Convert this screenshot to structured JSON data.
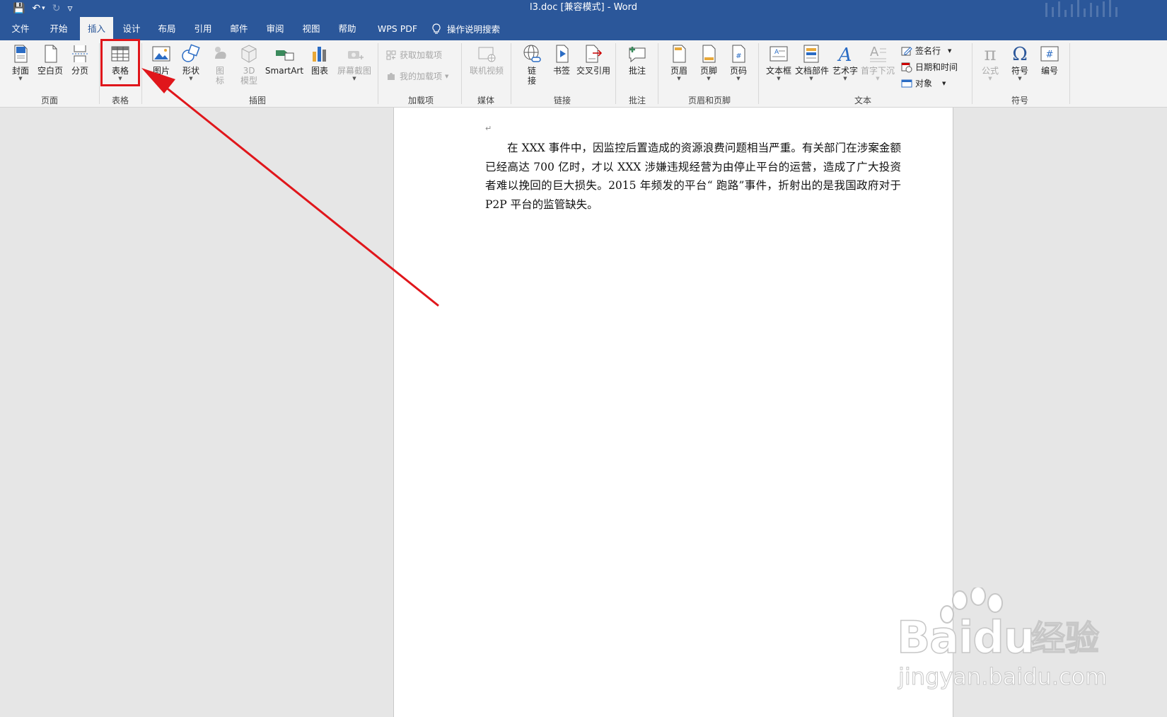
{
  "titlebar": {
    "title": "l3.doc [兼容模式]  -  Word",
    "qat": {
      "save": "💾",
      "undo": "↶",
      "undo_caret": "▾",
      "redo": "↻",
      "customize": "▿"
    }
  },
  "tabs": [
    {
      "label": "文件"
    },
    {
      "label": "开始"
    },
    {
      "label": "插入"
    },
    {
      "label": "设计"
    },
    {
      "label": "布局"
    },
    {
      "label": "引用"
    },
    {
      "label": "邮件"
    },
    {
      "label": "审阅"
    },
    {
      "label": "视图"
    },
    {
      "label": "帮助"
    },
    {
      "label": "WPS PDF"
    }
  ],
  "active_tab": "插入",
  "tell_me": "操作说明搜索",
  "ribbon": {
    "pages": {
      "label": "页面",
      "cover": "封面",
      "blank": "空白页",
      "break": "分页"
    },
    "tables": {
      "label": "表格",
      "table": "表格"
    },
    "illustrations": {
      "label": "插图",
      "picture": "图片",
      "shapes": "形状",
      "icons_1": "图",
      "icons_2": "标",
      "model_1": "3D",
      "model_2": "模型",
      "smartart": "SmartArt",
      "chart": "图表",
      "screenshot": "屏幕截图"
    },
    "addins": {
      "label": "加载项",
      "get": "获取加载项",
      "mine": "我的加载项"
    },
    "media": {
      "label": "媒体",
      "online_video": "联机视频"
    },
    "links": {
      "label": "链接",
      "link_1": "链",
      "link_2": "接",
      "bookmark": "书签",
      "crossref": "交叉引用"
    },
    "comments": {
      "label": "批注",
      "comment": "批注"
    },
    "header_footer": {
      "label": "页眉和页脚",
      "header": "页眉",
      "footer": "页脚",
      "page_number": "页码"
    },
    "text": {
      "label": "文本",
      "textbox": "文本框",
      "quickparts": "文档部件",
      "wordart": "艺术字",
      "dropcap": "首字下沉",
      "signature": "签名行",
      "datetime": "日期和时间",
      "object": "对象"
    },
    "symbols": {
      "label": "符号",
      "equation": "公式",
      "symbol": "符号",
      "number": "编号"
    }
  },
  "document": {
    "paragraph_mark": "↵",
    "text": "在 XXX 事件中，因监控后置造成的资源浪费问题相当严重。有关部门在涉案金额已经高达 700 亿时，才以 XXX 涉嫌违规经营为由停止平台的运营，造成了广大投资者难以挽回的巨大损失。2015 年频发的平台“ 跑路”事件，折射出的是我国政府对于 P2P 平台的监管缺失。"
  },
  "watermark": {
    "brand": "Baidu",
    "cn": "经验",
    "url": "jingyan.baidu.com"
  },
  "annotation": {
    "color": "#e0161b"
  },
  "colors": {
    "accent": "#2b579a",
    "ribbon_bg": "#f3f3f3",
    "doc_bg": "#e6e6e6"
  }
}
